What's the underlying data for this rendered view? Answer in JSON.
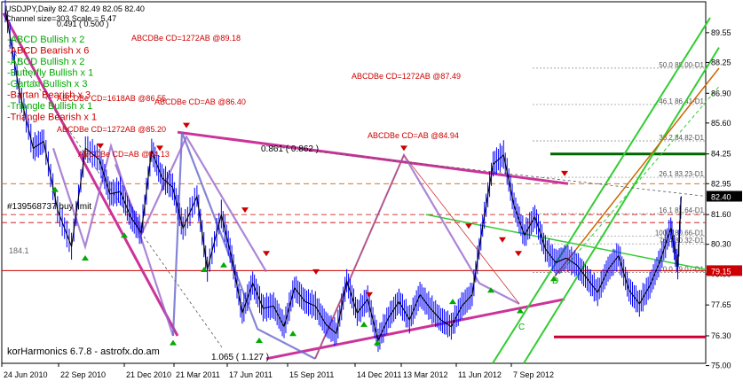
{
  "header": {
    "symbol_line": "USDJPY,Daily  82.47 82.49 82.05 82.40",
    "channel_line": "Channel size=303 Scale = 5.47",
    "ratio_line": "0.491 ( 0.500 )"
  },
  "colors": {
    "price_bar": "#0000ff",
    "price_close": "#000000",
    "bearish": "#cc0000",
    "bullish": "#00aa00",
    "magenta": "#cc3399",
    "pattern_blue": "#6666cc",
    "bright_green": "#33cc33",
    "orange": "#cc6600",
    "dark_green": "#006600",
    "current_price_bg": "#000000",
    "level_price_bg": "#cc0000"
  },
  "chart_data": {
    "type": "candlestick",
    "instrument": "USDJPY",
    "timeframe": "Daily",
    "ohlc_last": {
      "open": 82.47,
      "high": 82.49,
      "low": 82.05,
      "close": 82.4
    },
    "ylim": [
      75.1,
      90.9
    ],
    "y_ticks": [
      "89.55",
      "88.25",
      "86.90",
      "85.60",
      "84.25",
      "82.95",
      "81.60",
      "80.30",
      "79.00",
      "77.65",
      "76.30",
      "75.00"
    ],
    "y_tick_values": [
      89.55,
      88.25,
      86.9,
      85.6,
      84.25,
      82.95,
      81.6,
      80.3,
      79.0,
      77.65,
      76.3,
      75.0
    ],
    "x_ticks": [
      "24 Jun 2010",
      "22 Sep 2010",
      "21 Dec 2010",
      "21 Mar 2011",
      "17 Jun 2011",
      "15 Sep 2011",
      "14 Dec 2011",
      "13 Mar 2012",
      "11 Jun 2012",
      "7 Sep 2012"
    ],
    "price_path": [
      [
        0,
        90.6
      ],
      [
        0.04,
        87.0
      ],
      [
        0.08,
        84.5
      ],
      [
        0.11,
        84.8
      ],
      [
        0.15,
        81.8
      ],
      [
        0.19,
        80.2
      ],
      [
        0.23,
        84.5
      ],
      [
        0.27,
        84.0
      ],
      [
        0.3,
        82.5
      ],
      [
        0.33,
        82.6
      ],
      [
        0.36,
        81.5
      ],
      [
        0.39,
        80.8
      ],
      [
        0.42,
        84.4
      ],
      [
        0.45,
        83.2
      ],
      [
        0.48,
        82.8
      ],
      [
        0.51,
        81.0
      ],
      [
        0.55,
        82.4
      ],
      [
        0.58,
        79.2
      ],
      [
        0.62,
        81.6
      ],
      [
        0.65,
        79.7
      ],
      [
        0.68,
        77.3
      ],
      [
        0.71,
        78.6
      ],
      [
        0.74,
        77.5
      ],
      [
        0.77,
        77.6
      ],
      [
        0.8,
        76.7
      ],
      [
        0.83,
        78.4
      ],
      [
        0.86,
        77.8
      ],
      [
        0.89,
        77.6
      ],
      [
        0.92,
        76.8
      ],
      [
        0.95,
        76.4
      ],
      [
        0.98,
        78.7
      ],
      [
        1.01,
        77.3
      ],
      [
        1.04,
        77.9
      ],
      [
        1.07,
        76.1
      ],
      [
        1.1,
        77.1
      ],
      [
        1.13,
        77.8
      ],
      [
        1.16,
        77.0
      ],
      [
        1.19,
        78.1
      ],
      [
        1.22,
        77.5
      ],
      [
        1.25,
        77.0
      ],
      [
        1.28,
        76.7
      ],
      [
        1.31,
        77.6
      ],
      [
        1.34,
        78.1
      ],
      [
        1.37,
        81.1
      ],
      [
        1.4,
        83.8
      ],
      [
        1.43,
        84.2
      ],
      [
        1.46,
        82.0
      ],
      [
        1.49,
        80.7
      ],
      [
        1.52,
        81.5
      ],
      [
        1.55,
        80.1
      ],
      [
        1.58,
        79.5
      ],
      [
        1.61,
        79.7
      ],
      [
        1.64,
        79.4
      ],
      [
        1.67,
        78.8
      ],
      [
        1.7,
        78.2
      ],
      [
        1.73,
        79.2
      ],
      [
        1.76,
        79.8
      ],
      [
        1.79,
        78.3
      ],
      [
        1.82,
        77.7
      ],
      [
        1.85,
        78.5
      ],
      [
        1.88,
        79.6
      ],
      [
        1.91,
        81.0
      ],
      [
        1.93,
        79.3
      ],
      [
        1.94,
        82.4
      ]
    ],
    "pattern_lines_note": "ABCD / butterfly / Gartley harmonic lines drawn in blue and magenta",
    "horizontal_levels": [
      {
        "label": "50.0 88.00-D1",
        "value": 88.0
      },
      {
        "label": "46.1 86.41-D1",
        "value": 86.41
      },
      {
        "label": "38.2 84.82-D1",
        "value": 84.82
      },
      {
        "label": "26.1 83.23-D1",
        "value": 83.23
      },
      {
        "label": "16.1 81.64-D1",
        "value": 81.64
      },
      {
        "label": "100.0 80.66-D1",
        "value": 80.66
      },
      {
        "label": "76.4 80.32-D1",
        "value": 80.32
      },
      {
        "label": "0.0 79.07-D1",
        "value": 79.07
      }
    ],
    "current_price": {
      "label": "82.40",
      "value": 82.4
    },
    "level_price": {
      "label": "79.15",
      "value": 79.15
    },
    "green_level": 84.25,
    "red_level": 76.25,
    "annotations": [
      {
        "text": "ABCDBe CD=1272AB  @89.18",
        "color": "bearish"
      },
      {
        "text": "ABCDBe CD=1272AB  @87.49",
        "color": "bearish"
      },
      {
        "text": "ABCDBe CD=1618AB  @86.55",
        "color": "bearish"
      },
      {
        "text": "ABCDBe CD=AB  @86.40",
        "color": "bearish"
      },
      {
        "text": "ABCDBe CD=1272AB  @85.20",
        "color": "bearish"
      },
      {
        "text": "ABCDBe CD=AB  @84.94",
        "color": "bearish"
      },
      {
        "text": "ABCDBe CD=AB  @84.13",
        "color": "bearish"
      },
      {
        "text": "0.861 ( 0.862 )",
        "color": "black"
      },
      {
        "text": "1.065 ( 1.127 )",
        "color": "black"
      },
      {
        "text": "184.1",
        "color": "gray"
      },
      {
        "text": "#139568737 buy limit",
        "color": "black"
      },
      {
        "text": "D",
        "color": "bullish"
      },
      {
        "text": "C",
        "color": "bullish"
      }
    ],
    "pattern_legend": [
      {
        "text": "-ABCD Bullish x 2",
        "color": "bullish"
      },
      {
        "text": "-ABCD Bearish x 6",
        "color": "bearish"
      },
      {
        "text": "-ABCD Bullish x 2",
        "color": "bullish"
      },
      {
        "text": "-Butterfly Bullish x 1",
        "color": "bullish"
      },
      {
        "text": "-Gartan Bullish x 3",
        "color": "bullish"
      },
      {
        "text": "-Bartan Bearish x 3",
        "color": "bearish"
      },
      {
        "text": "-Triangle Bullish x 1",
        "color": "bullish"
      },
      {
        "text": "-Triangle Bearish x 1",
        "color": "bearish"
      }
    ],
    "footer_text": "korHarmonics 6.7.8 - astrofx.do.am"
  }
}
